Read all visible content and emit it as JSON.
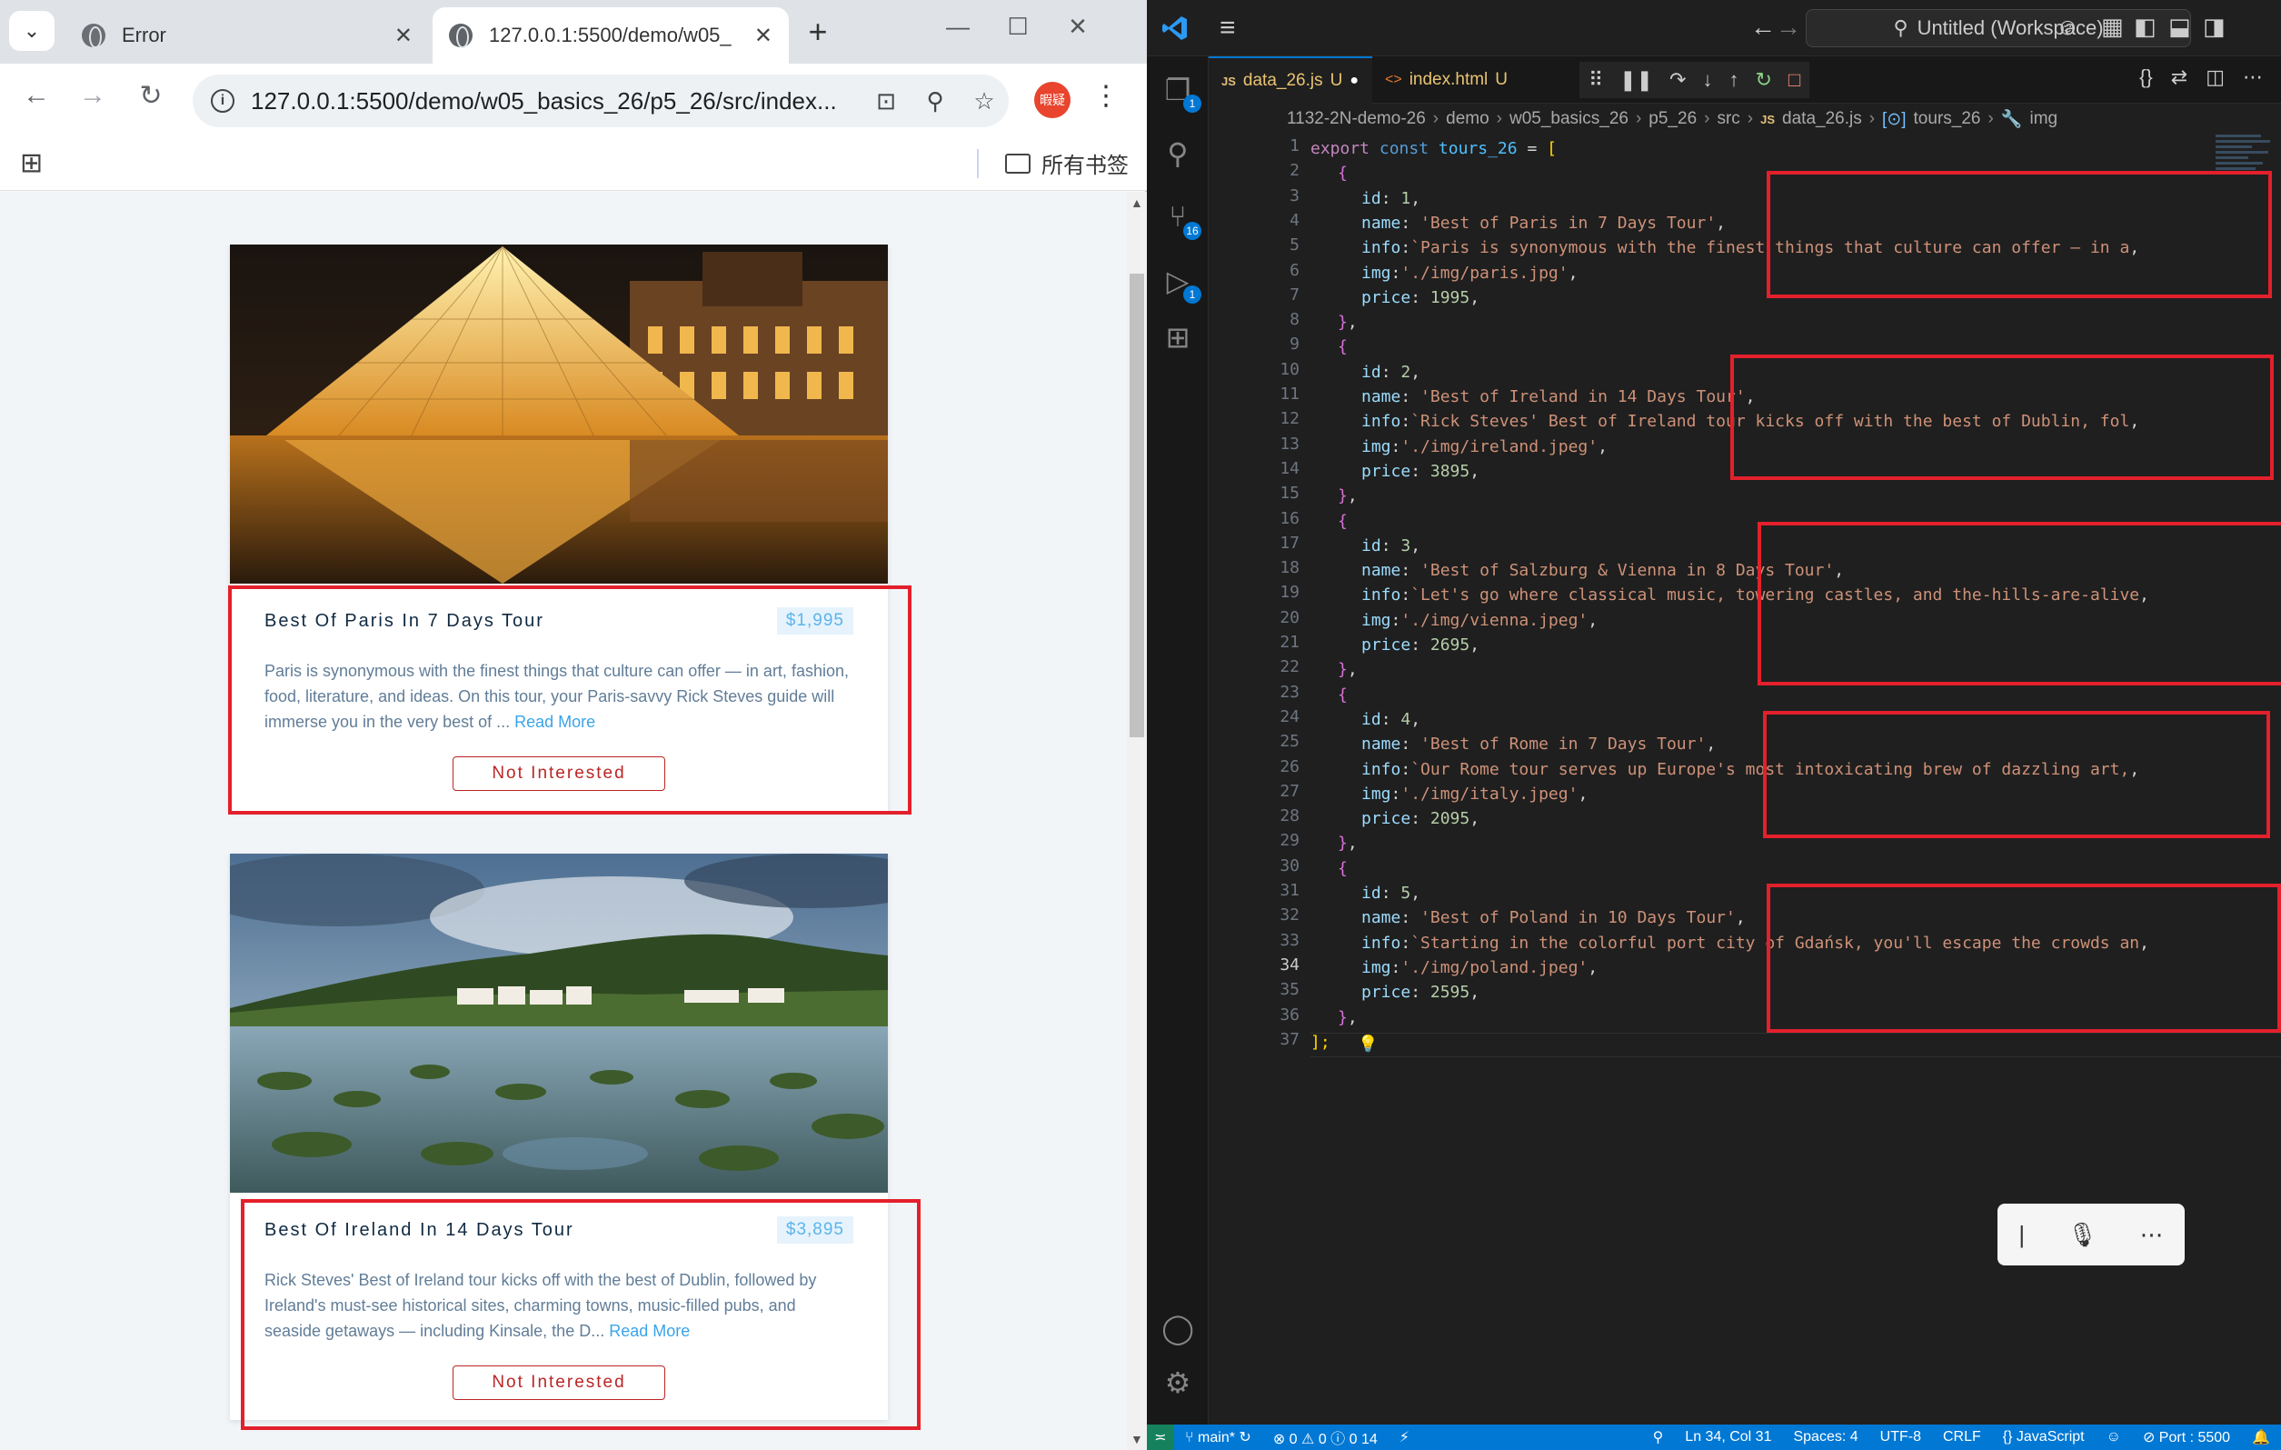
{
  "browser": {
    "tabs": [
      {
        "title": "Error"
      },
      {
        "title": "127.0.0.1:5500/demo/w05_"
      }
    ],
    "url": "127.0.0.1:5500/demo/w05_basics_26/p5_26/src/index...",
    "profile_label": "暇疑",
    "bookmarks_folder": "所有书签"
  },
  "tours": [
    {
      "name": "Best Of Paris In 7 Days Tour",
      "price": "$1,995",
      "info": "Paris is synonymous with the finest things that culture can offer — in art, fashion, food, literature, and ideas. On this tour, your Paris-savvy Rick Steves guide will immerse you in the very best of ...",
      "read_more": "Read More",
      "button": "Not Interested"
    },
    {
      "name": "Best Of Ireland In 14 Days Tour",
      "price": "$3,895",
      "info": "Rick Steves' Best of Ireland tour kicks off with the best of Dublin, followed by Ireland's must-see historical sites, charming towns, music-filled pubs, and seaside getaways — including Kinsale, the D...",
      "read_more": "Read More",
      "button": "Not Interested"
    }
  ],
  "vscode": {
    "command_center": "Untitled (Workspace)",
    "tabs": [
      {
        "label": "data_26.js",
        "status": "U",
        "prefix": "JS"
      },
      {
        "label": "index.html",
        "status": "U",
        "prefix": "<>"
      }
    ],
    "breadcrumbs": [
      "1132-2N-demo-26",
      "demo",
      "w05_basics_26",
      "p5_26",
      "src",
      "data_26.js",
      "tours_26",
      "img"
    ],
    "badges": {
      "explorer": "1",
      "scm": "16",
      "debug": "1"
    },
    "line_numbers": [
      "1",
      "2",
      "3",
      "4",
      "5",
      "6",
      "7",
      "8",
      "9",
      "10",
      "11",
      "12",
      "13",
      "14",
      "15",
      "16",
      "17",
      "18",
      "19",
      "20",
      "21",
      "22",
      "23",
      "24",
      "25",
      "26",
      "27",
      "28",
      "29",
      "30",
      "31",
      "32",
      "33",
      "34",
      "35",
      "36",
      "37"
    ],
    "current_line": "34",
    "code": {
      "export_kw": "export",
      "const_kw": "const",
      "var_name": "tours_26",
      "eq": "=",
      "open_bracket": "[",
      "close_bracket": "];",
      "items": [
        {
          "id": "1",
          "name": "'Best of Paris in 7 Days Tour'",
          "info": "`Paris is synonymous with the finest things that culture can offer — in a",
          "img": "'./img/paris.jpg'",
          "price": "1995"
        },
        {
          "id": "2",
          "name": "'Best of Ireland in 14 Days Tour'",
          "info": "`Rick Steves' Best of Ireland tour kicks off with the best of Dublin, fol",
          "img": "'./img/ireland.jpeg'",
          "price": "3895"
        },
        {
          "id": "3",
          "name": "'Best of Salzburg & Vienna in 8 Days Tour'",
          "info": "`Let's go where classical music, towering castles, and the-hills-are-alive",
          "img": "'./img/vienna.jpeg'",
          "price": "2695"
        },
        {
          "id": "4",
          "name": "'Best of Rome in 7 Days Tour'",
          "info": "`Our Rome tour serves up Europe's most intoxicating brew of dazzling art,",
          "img": "'./img/italy.jpeg'",
          "price": "2095"
        },
        {
          "id": "5",
          "name": "'Best of Poland in 10 Days Tour'",
          "info": "`Starting in the colorful port city of Gdańsk, you'll escape the crowds an",
          "img": "'./img/poland.jpeg'",
          "price": "2595"
        }
      ]
    },
    "status": {
      "branch": "main*",
      "errors": "0",
      "warnings": "0",
      "info": "0",
      "ports": "14",
      "position": "Ln 34, Col 31",
      "spaces": "Spaces: 4",
      "encoding": "UTF-8",
      "eol": "CRLF",
      "language": "JavaScript",
      "port": "Port : 5500"
    }
  }
}
